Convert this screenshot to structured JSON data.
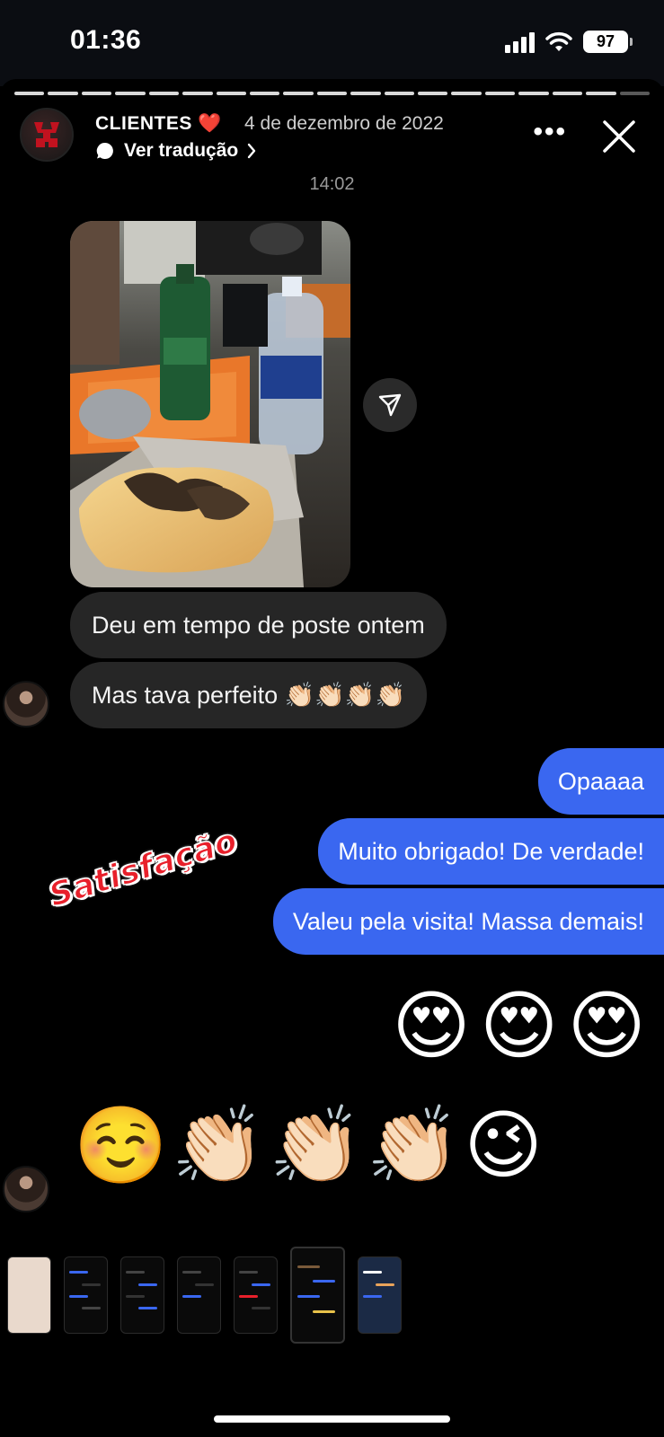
{
  "status_bar": {
    "time": "01:36",
    "battery": "97",
    "icons": [
      "cellular-signal-icon",
      "wifi-icon",
      "battery-icon"
    ]
  },
  "story": {
    "user_name": "CLIENTES",
    "heart": "❤️",
    "date": "4 de dezembro de 2022",
    "translate_label": "Ver tradução",
    "more_label": "•••",
    "progress_segments": 19,
    "progress_current": 18
  },
  "conversation": {
    "time": "14:02",
    "incoming": [
      "Deu em tempo de poste ontem",
      "Mas tava perfeito 👏🏻👏🏻👏🏻👏🏻"
    ],
    "outgoing": [
      "Opaaaa",
      "Muito obrigado! De verdade!",
      "Valeu pela visita! Massa demais!"
    ],
    "outgoing_emojis": "😍😍😍",
    "incoming_emojis": "☺️👏🏻👏🏻👏🏻😉"
  },
  "sticker_text": "Satisfação",
  "colors": {
    "outgoing_bubble": "#3a67f0",
    "incoming_bubble": "#262626",
    "sticker_red": "#e8202b"
  },
  "thumbnails": {
    "count": 7,
    "active_index": 5
  }
}
